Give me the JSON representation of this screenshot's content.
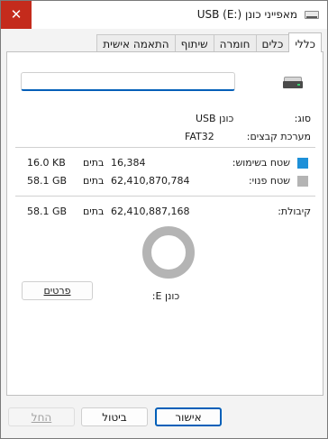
{
  "window": {
    "title": "מאפייני כונן USB (E:)",
    "close_glyph": "✕"
  },
  "tabs": [
    {
      "label": "כללי",
      "active": true
    },
    {
      "label": "כלים",
      "active": false
    },
    {
      "label": "חומרה",
      "active": false
    },
    {
      "label": "שיתוף",
      "active": false
    },
    {
      "label": "התאמה אישית",
      "active": false
    }
  ],
  "general": {
    "drive_name_value": "",
    "type_label": "סוג:",
    "type_value": "כונן USB",
    "filesystem_label": "מערכת קבצים:",
    "filesystem_value": "FAT32",
    "used": {
      "label": "שטח בשימוש:",
      "bytes": "16,384",
      "bytes_unit": "בתים",
      "size": "16.0 KB",
      "color": "#1e90d8"
    },
    "free": {
      "label": "שטח פנוי:",
      "bytes": "62,410,870,784",
      "bytes_unit": "בתים",
      "size": "58.1 GB",
      "color": "#b4b4b4"
    },
    "capacity": {
      "label": "קיבולת:",
      "bytes": "62,410,887,168",
      "bytes_unit": "בתים",
      "size": "58.1 GB"
    },
    "used_fraction": 3e-07,
    "drive_caption": "כונן E:",
    "details_button": "פרטים"
  },
  "footer": {
    "ok": "אישור",
    "cancel": "ביטול",
    "apply": "החל"
  }
}
